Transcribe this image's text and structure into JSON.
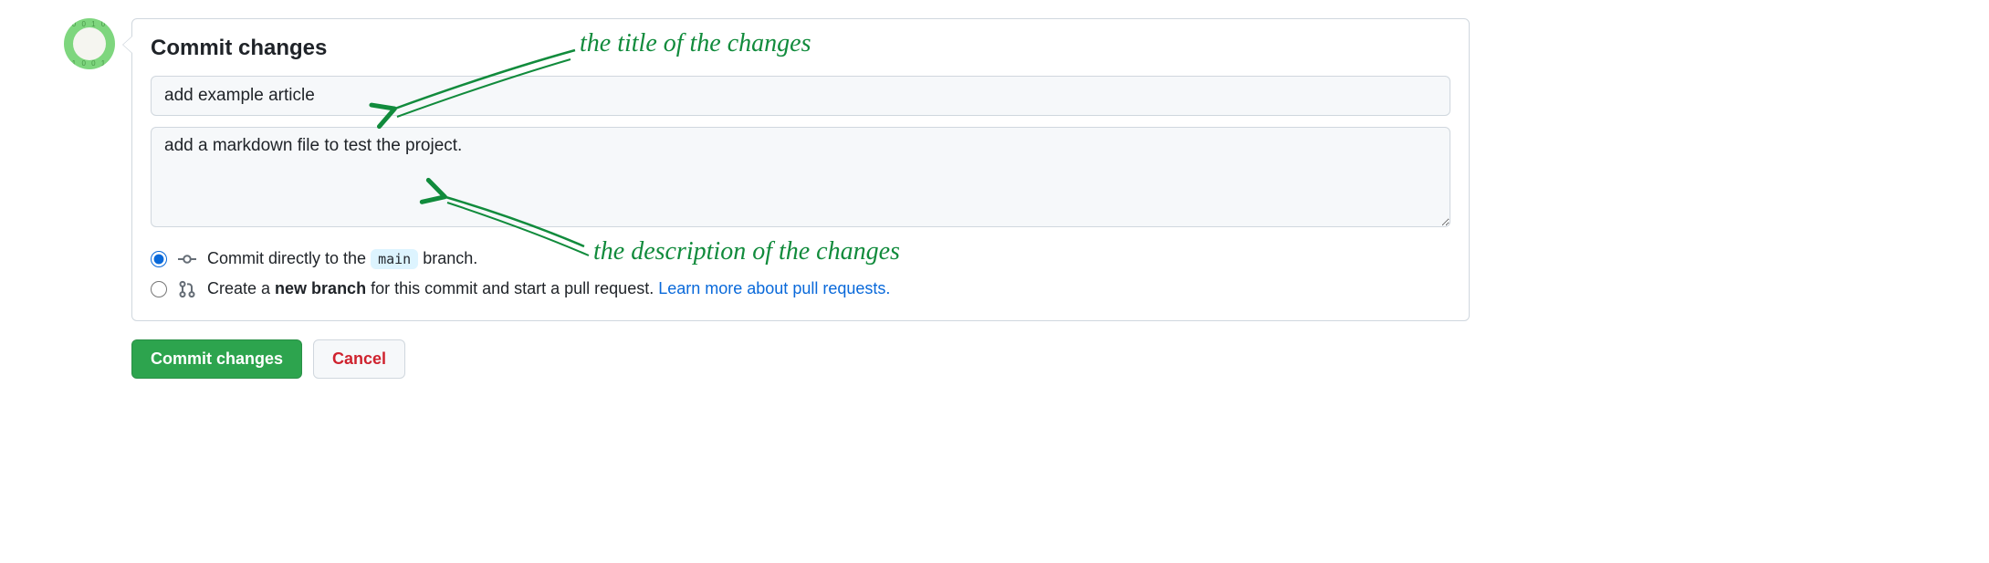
{
  "panel": {
    "title": "Commit changes",
    "summary_value": "add example article",
    "description_value": "add a markdown file to test the project."
  },
  "branch": {
    "option1_prefix": "Commit directly to the ",
    "option1_branch": "main",
    "option1_suffix": " branch.",
    "option2_prefix": "Create a ",
    "option2_strong": "new branch",
    "option2_suffix": " for this commit and start a pull request. ",
    "learn_more": "Learn more about pull requests."
  },
  "buttons": {
    "commit": "Commit changes",
    "cancel": "Cancel"
  },
  "annotations": {
    "title_note": "the title of the changes",
    "desc_note": "the description of the changes",
    "color": "#118b3c"
  }
}
